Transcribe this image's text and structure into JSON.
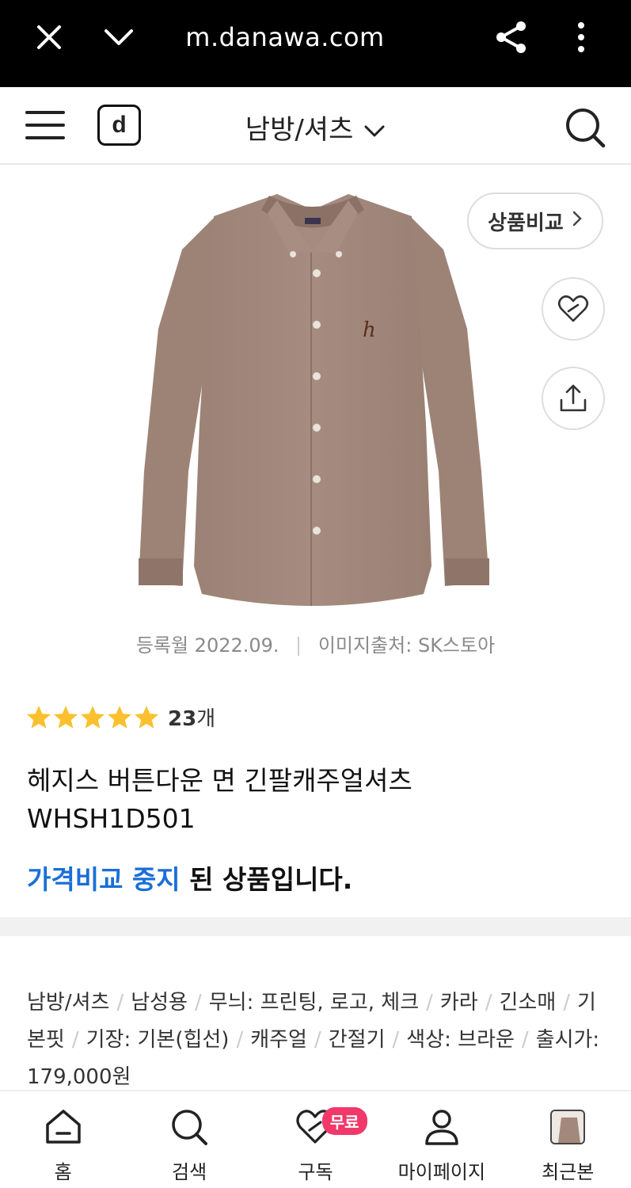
{
  "browser": {
    "url": "m.danawa.com"
  },
  "header": {
    "logo": "d",
    "category": "남방/셔츠"
  },
  "product": {
    "compare_label": "상품비교",
    "registered": "등록월 2022.09.",
    "image_source": "이미지출처: SK스토아",
    "rating_count": "23",
    "rating_unit": "개",
    "rating_stars": 5,
    "title_line1": "헤지스 버튼다운 면 긴팔캐주얼셔츠",
    "title_line2": "WHSH1D501",
    "notice_blue": "가격비교 중지",
    "notice_rest": " 된 상품입니다.",
    "specs": [
      "남방/셔츠",
      "남성용",
      "무늬: 프린팅, 로고, 체크",
      "카라",
      "긴소매",
      "기본핏",
      "기장: 기본(힙선)",
      "캐주얼",
      "간절기",
      "색상: 브라운",
      "출시가: 179,000원"
    ]
  },
  "colors": {
    "accent_blue": "#1a6fd6",
    "star": "#fbc02d",
    "badge": "#f0386b",
    "shirt": "#a3897c"
  },
  "nav": {
    "home": "홈",
    "search": "검색",
    "subscribe": "구독",
    "subscribe_badge": "무료",
    "mypage": "마이페이지",
    "recent": "최근본"
  }
}
